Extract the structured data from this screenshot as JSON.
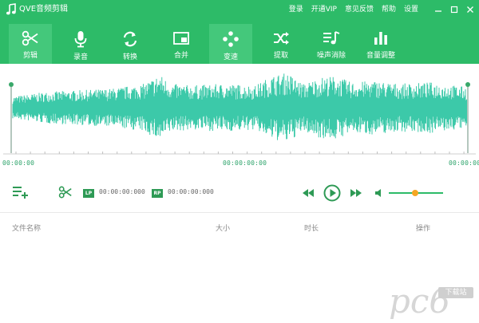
{
  "app": {
    "title": "QVE音频剪辑"
  },
  "top_menu": {
    "items": [
      {
        "label": "登录"
      },
      {
        "label": "开通VIP"
      },
      {
        "label": "意见反馈"
      },
      {
        "label": "帮助"
      },
      {
        "label": "设置"
      }
    ]
  },
  "toolbar": {
    "tools": [
      {
        "label": "剪辑",
        "icon": "scissors-icon",
        "active": true
      },
      {
        "label": "录音",
        "icon": "microphone-icon",
        "active": false
      },
      {
        "label": "转换",
        "icon": "convert-icon",
        "active": false
      },
      {
        "label": "合并",
        "icon": "merge-icon",
        "active": false
      },
      {
        "label": "变速",
        "icon": "speed-icon",
        "active": true
      },
      {
        "label": "提取",
        "icon": "shuffle-icon",
        "active": false
      },
      {
        "label": "噪声消除",
        "icon": "noise-removal-icon",
        "active": false
      },
      {
        "label": "音量调整",
        "icon": "volume-bars-icon",
        "active": false
      }
    ]
  },
  "waveform": {
    "color": "#3cc9a9",
    "time_start": "00:00:00",
    "time_mid": "00:00:00:00",
    "time_end": "00:00:00"
  },
  "controls": {
    "lp_badge": "LP",
    "lp_time": "00:00:00:000",
    "rp_badge": "RP",
    "rp_time": "00:00:00:000",
    "volume_level": 0.48
  },
  "file_list": {
    "columns": {
      "name": "文件名称",
      "size": "大小",
      "duration": "时长",
      "actions": "操作"
    }
  },
  "watermark": {
    "brand": "pc6",
    "tag": "下载站"
  },
  "colors": {
    "accent": "#2dbb68",
    "accent_dark": "#2e9a55",
    "knob": "#f5a623"
  }
}
